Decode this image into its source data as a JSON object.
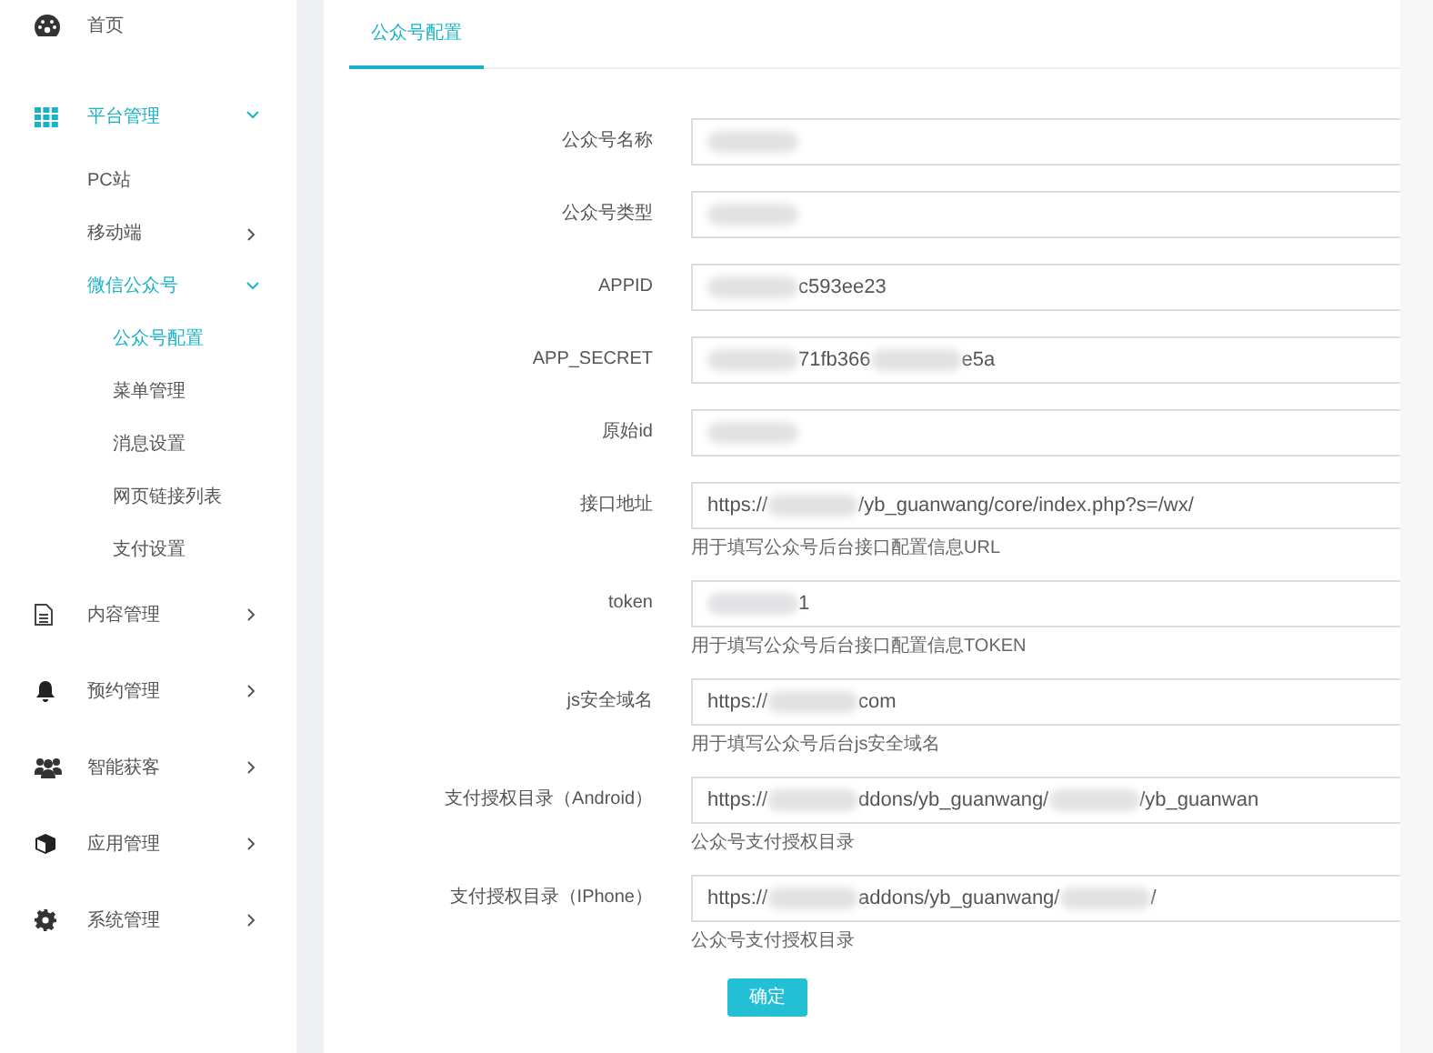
{
  "sidebar": {
    "items": [
      {
        "label": "首页",
        "highlighted": false
      },
      {
        "label": "平台管理",
        "highlighted": true,
        "expanded": true,
        "children": [
          {
            "label": "PC站",
            "highlighted": false
          },
          {
            "label": "移动端",
            "highlighted": false,
            "expanded": false
          },
          {
            "label": "微信公众号",
            "highlighted": true,
            "expanded": true,
            "children": [
              {
                "label": "公众号配置",
                "highlighted": true
              },
              {
                "label": "菜单管理",
                "highlighted": false
              },
              {
                "label": "消息设置",
                "highlighted": false
              },
              {
                "label": "网页链接列表",
                "highlighted": false
              },
              {
                "label": "支付设置",
                "highlighted": false
              }
            ]
          }
        ]
      },
      {
        "label": "内容管理",
        "highlighted": false,
        "expanded": false
      },
      {
        "label": "预约管理",
        "highlighted": false,
        "expanded": false
      },
      {
        "label": "智能获客",
        "highlighted": false,
        "expanded": false
      },
      {
        "label": "应用管理",
        "highlighted": false,
        "expanded": false
      },
      {
        "label": "系统管理",
        "highlighted": false,
        "expanded": false
      }
    ]
  },
  "tabs": [
    {
      "label": "公众号配置",
      "selected": true
    }
  ],
  "form": {
    "fields": [
      {
        "label": "公众号名称",
        "value_parts": [
          {
            "kind": "redacted"
          }
        ]
      },
      {
        "label": "公众号类型",
        "value_parts": [
          {
            "kind": "redacted"
          }
        ]
      },
      {
        "label": "APPID",
        "value_parts": [
          {
            "kind": "redacted"
          },
          {
            "kind": "text",
            "text": "c593ee23"
          }
        ]
      },
      {
        "label": "APP_SECRET",
        "value_parts": [
          {
            "kind": "redacted"
          },
          {
            "kind": "text",
            "text": "71fb366"
          },
          {
            "kind": "redacted"
          },
          {
            "kind": "text",
            "text": "e5a"
          }
        ]
      },
      {
        "label": "原始id",
        "value_parts": [
          {
            "kind": "redacted"
          }
        ]
      },
      {
        "label": "接口地址",
        "value_parts": [
          {
            "kind": "text",
            "text": "https://"
          },
          {
            "kind": "redacted"
          },
          {
            "kind": "text",
            "text": "/yb_guanwang/core/index.php?s=/wx/"
          }
        ],
        "help": "用于填写公众号后台接口配置信息URL"
      },
      {
        "label": "token",
        "value_parts": [
          {
            "kind": "redacted"
          },
          {
            "kind": "text",
            "text": "1"
          }
        ],
        "help": "用于填写公众号后台接口配置信息TOKEN"
      },
      {
        "label": "js安全域名",
        "value_parts": [
          {
            "kind": "text",
            "text": "https://"
          },
          {
            "kind": "redacted"
          },
          {
            "kind": "text",
            "text": "com"
          }
        ],
        "help": "用于填写公众号后台js安全域名"
      },
      {
        "label": "支付授权目录（Android）",
        "value_parts": [
          {
            "kind": "text",
            "text": "https://"
          },
          {
            "kind": "redacted"
          },
          {
            "kind": "text",
            "text": "ddons/yb_guanwang/"
          },
          {
            "kind": "redacted"
          },
          {
            "kind": "text",
            "text": "/yb_guanwan"
          }
        ],
        "help": "公众号支付授权目录"
      },
      {
        "label": "支付授权目录（IPhone）",
        "value_parts": [
          {
            "kind": "text",
            "text": "https://"
          },
          {
            "kind": "redacted"
          },
          {
            "kind": "text",
            "text": "addons/yb_guanwang/"
          },
          {
            "kind": "redacted"
          },
          {
            "kind": "text",
            "text": "/"
          }
        ],
        "help": "公众号支付授权目录"
      }
    ],
    "submit": "确定"
  }
}
